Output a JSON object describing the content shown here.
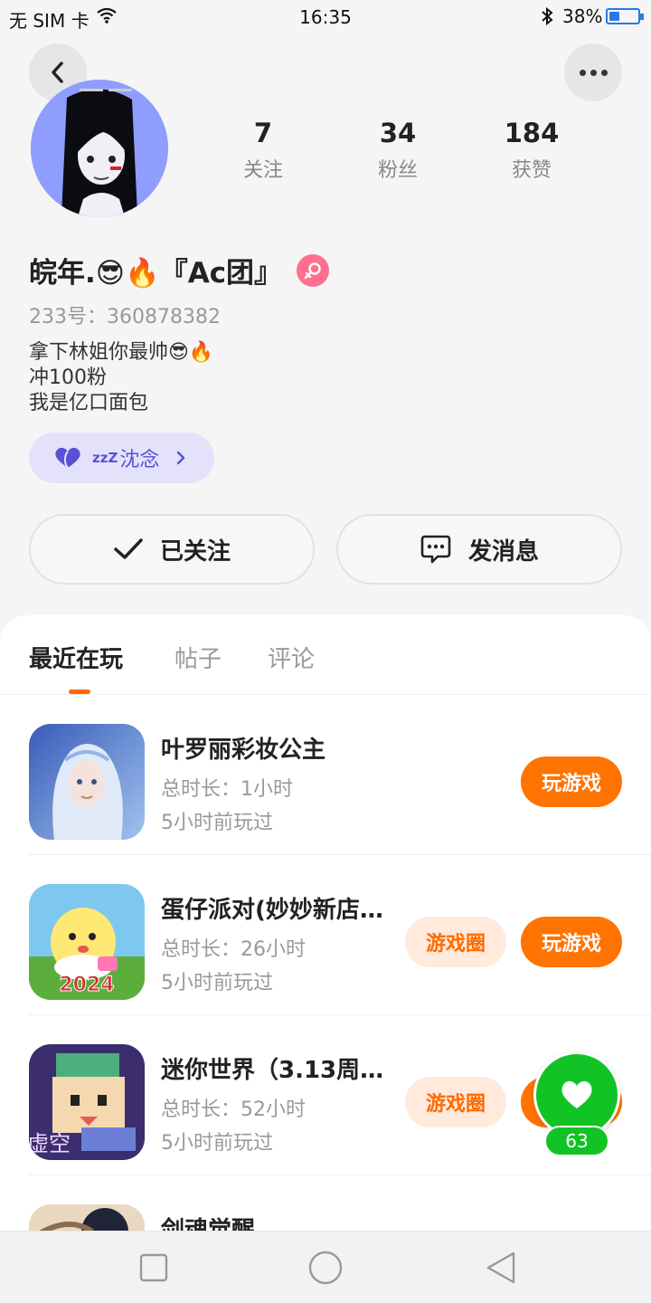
{
  "status_bar": {
    "carrier": "无 SIM 卡",
    "time": "16:35",
    "battery_text": "38%",
    "battery_level": 0.38
  },
  "header": {
    "back_icon": "chevron-left-icon",
    "more_icon": "more-dots-icon"
  },
  "profile": {
    "stats": [
      {
        "value": "7",
        "label": "关注"
      },
      {
        "value": "34",
        "label": "粉丝"
      },
      {
        "value": "184",
        "label": "获赞"
      }
    ],
    "nickname": "皖年.😎🔥『Ac团』",
    "user_id": "233号：360878382",
    "bio": [
      "拿下林姐你最帅😎🔥",
      "冲100粉",
      "我是亿口面包"
    ],
    "status_zz": "zzZ",
    "status_text": "沈念",
    "follow_button": "已关注",
    "message_button": "发消息"
  },
  "tabs": [
    {
      "label": "最近在玩",
      "active": true
    },
    {
      "label": "帖子",
      "active": false
    },
    {
      "label": "评论",
      "active": false
    }
  ],
  "games": [
    {
      "name": "叶罗丽彩妆公主",
      "duration": "总时长：1小时",
      "last_played": "5小时前玩过",
      "circle_button": null,
      "play_button": "玩游戏"
    },
    {
      "name": "蛋仔派对(妙妙新店…",
      "duration": "总时长：26小时",
      "last_played": "5小时前玩过",
      "circle_button": "游戏圈",
      "play_button": "玩游戏"
    },
    {
      "name": "迷你世界（3.13周…",
      "duration": "总时长：52小时",
      "last_played": "5小时前玩过",
      "circle_button": "游戏圈",
      "play_button": "玩游戏"
    },
    {
      "name": "剑魂觉醒",
      "duration": "",
      "last_played": "",
      "circle_button": null,
      "play_button": null
    }
  ],
  "game_icon_text": {
    "egg_year": "2024",
    "mini_tag": "虚空"
  },
  "like_float": {
    "count": "63"
  },
  "colors": {
    "accent": "#ff7300",
    "like": "#12c326",
    "badge_female": "#ff6f8e",
    "status_pill": "#e4e2fb"
  }
}
